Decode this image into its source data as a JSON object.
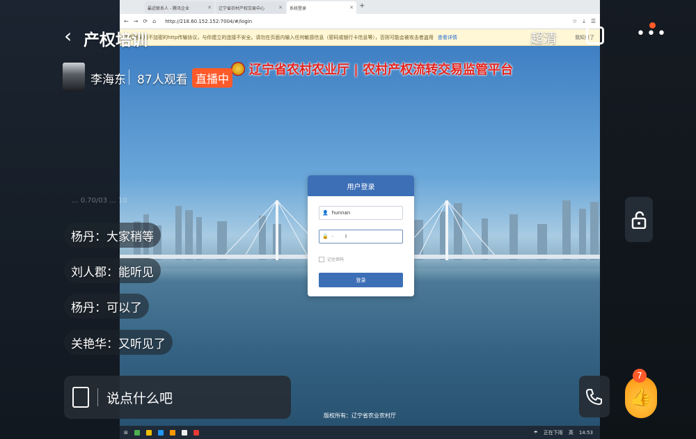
{
  "browser": {
    "tabs": [
      {
        "label": "最近联系人 - 腾讯企业"
      },
      {
        "label": "辽宁省农村产权交易中心"
      },
      {
        "label": "系统登录"
      }
    ],
    "url": "http://218.60.152.152:7004/#/login",
    "security_notice": "该页面采用不加密的http传输协议，与你建立的连接不安全。请勿在页面内输入任何敏感信息（密码或银行卡信息等），否则可能会被攻击者盗用",
    "security_link": "查看详情",
    "security_dismiss": "我知道了"
  },
  "site": {
    "title": "辽宁省农村农业厅 | 农村产权流转交易监管平台",
    "copyright": "版权所有：辽宁省农业农村厅"
  },
  "login": {
    "heading": "用户登录",
    "username_value": "hunnan",
    "password_value": "·",
    "remember_label": "记住密码",
    "submit_label": "登录"
  },
  "taskbar": {
    "weather": "正在下雨",
    "ime": "英",
    "time": "14:53"
  },
  "stream": {
    "back_icon": "chevron-left-icon",
    "room_title": "产权培训",
    "quality": "超清",
    "host_name": "李海东",
    "viewers": "87人观看",
    "live_badge": "直播中",
    "ghost_text": "... 0.70/03 ... 10",
    "comments": [
      {
        "text": "杨丹：大家稍等"
      },
      {
        "text": "刘人郡：能听见"
      },
      {
        "text": "杨丹：可以了"
      },
      {
        "text": "关艳华：又听见了"
      }
    ],
    "input_placeholder": "说点什么吧",
    "like_count": "7",
    "colors": {
      "accent": "#ff5a2a",
      "title_red": "#e4241f",
      "login_blue": "#3d6fb6"
    }
  }
}
